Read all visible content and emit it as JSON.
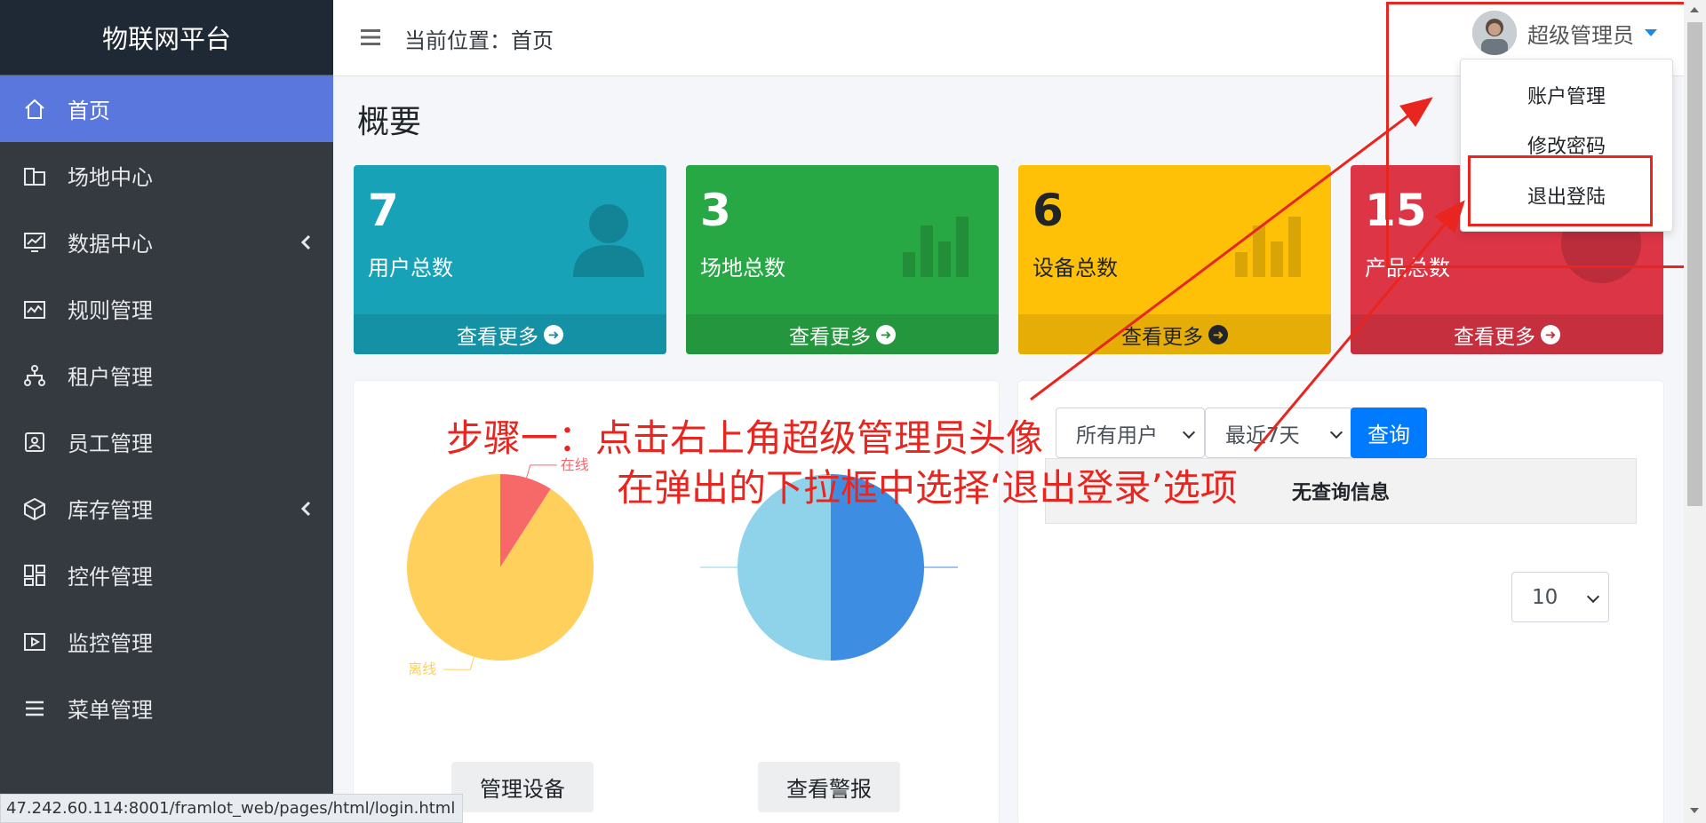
{
  "brand": "物联网平台",
  "nav": [
    {
      "label": "首页",
      "icon": "home-icon",
      "active": true
    },
    {
      "label": "场地中心",
      "icon": "building-icon"
    },
    {
      "label": "数据中心",
      "icon": "chart-monitor-icon",
      "expandable": true
    },
    {
      "label": "规则管理",
      "icon": "rules-icon"
    },
    {
      "label": "租户管理",
      "icon": "sitemap-icon"
    },
    {
      "label": "员工管理",
      "icon": "id-card-icon"
    },
    {
      "label": "库存管理",
      "icon": "box-icon",
      "expandable": true
    },
    {
      "label": "控件管理",
      "icon": "widgets-icon"
    },
    {
      "label": "监控管理",
      "icon": "play-icon"
    },
    {
      "label": "菜单管理",
      "icon": "list-icon"
    }
  ],
  "header": {
    "breadcrumb": "当前位置：首页",
    "user_name": "超级管理员"
  },
  "user_menu": [
    "账户管理",
    "修改密码",
    "退出登陆"
  ],
  "page_title": "概要",
  "stats": [
    {
      "value": "7",
      "label": "用户总数",
      "more": "查看更多",
      "color": "#17a2b8",
      "footer_color": "#1591a5",
      "icon": "user-icon"
    },
    {
      "value": "3",
      "label": "场地总数",
      "more": "查看更多",
      "color": "#28a745",
      "footer_color": "#24963e",
      "icon": "bar-chart-icon"
    },
    {
      "value": "6",
      "label": "设备总数",
      "more": "查看更多",
      "color": "#ffc107",
      "footer_color": "#e5ad06",
      "icon": "bar-chart-icon"
    },
    {
      "value": "15",
      "label": "产品总数",
      "more": "查看更多",
      "color": "#dc3545",
      "footer_color": "#c6303e",
      "icon": "pie-chart-icon"
    }
  ],
  "chart_data": [
    {
      "type": "pie",
      "labels": [
        "在线",
        "离线"
      ],
      "values": [
        1,
        10
      ],
      "colors": [
        "#f76868",
        "#ffd05b"
      ]
    },
    {
      "type": "pie",
      "values": [
        1,
        1
      ],
      "colors": [
        "#3d8ee3",
        "#8fd3ea"
      ]
    }
  ],
  "buttons": {
    "manage_devices": "管理设备",
    "view_alarms": "查看警报",
    "query": "查询"
  },
  "filters": {
    "user": "所有用户",
    "range": "最近7天",
    "page_size": "10"
  },
  "empty_text": "无查询信息",
  "status_url": "47.242.60.114:8001/framlot_web/pages/html/login.html",
  "annotation": {
    "line1": "步骤一：点击右上角超级管理员头像",
    "line2": "在弹出的下拉框中选择‘退出登录’选项"
  }
}
